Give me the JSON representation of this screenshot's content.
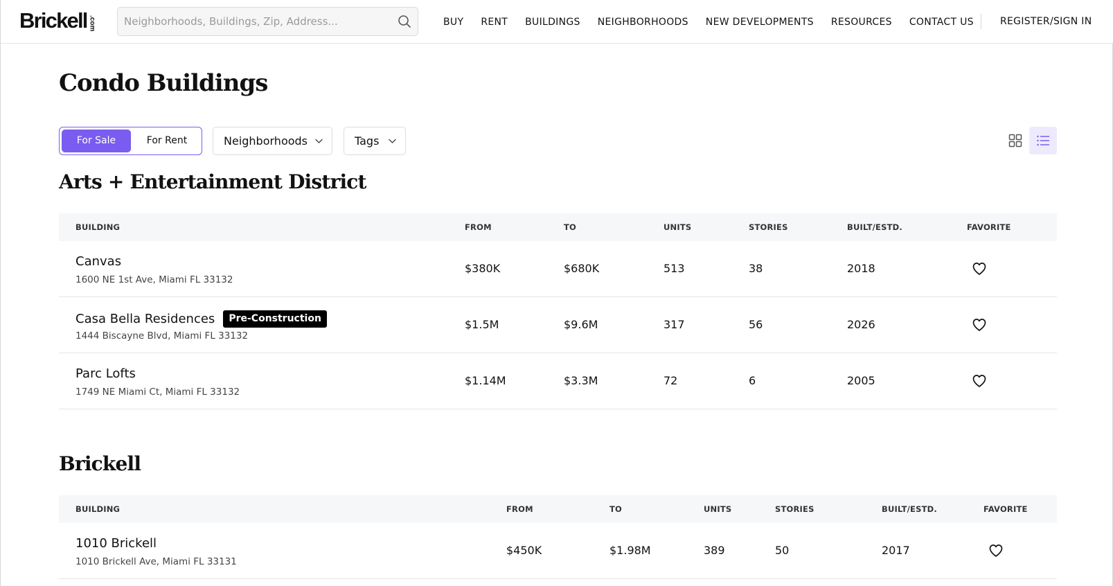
{
  "header": {
    "logo_main": "Brickell",
    "logo_sub": ".com",
    "search_placeholder": "Neighborhoods, Buildings, Zip, Address...",
    "nav": [
      "BUY",
      "RENT",
      "BUILDINGS",
      "NEIGHBORHOODS",
      "NEW DEVELOPMENTS",
      "RESOURCES",
      "CONTACT US"
    ],
    "signin": "REGISTER/SIGN IN"
  },
  "page": {
    "title": "Condo Buildings",
    "toggle": {
      "for_sale": "For Sale",
      "for_rent": "For Rent",
      "selected": "For Sale"
    },
    "filters": {
      "neighborhoods": "Neighborhoods",
      "tags": "Tags"
    },
    "view_mode": "list"
  },
  "colors": {
    "accent": "#7a5cf0",
    "accent_light": "#eeeafd",
    "badge_bg": "#000000"
  },
  "columns": [
    "BUILDING",
    "FROM",
    "TO",
    "UNITS",
    "STORIES",
    "BUILT/ESTD.",
    "FAVORITE"
  ],
  "sections": [
    {
      "title": "Arts + Entertainment District",
      "rows": [
        {
          "name": "Canvas",
          "badge": "",
          "address": "1600 NE 1st Ave, Miami FL 33132",
          "from": "$380K",
          "to": "$680K",
          "units": "513",
          "stories": "38",
          "built": "2018"
        },
        {
          "name": "Casa Bella Residences",
          "badge": "Pre-Construction",
          "address": "1444 Biscayne Blvd, Miami FL 33132",
          "from": "$1.5M",
          "to": "$9.6M",
          "units": "317",
          "stories": "56",
          "built": "2026"
        },
        {
          "name": "Parc Lofts",
          "badge": "",
          "address": "1749 NE Miami Ct, Miami FL 33132",
          "from": "$1.14M",
          "to": "$3.3M",
          "units": "72",
          "stories": "6",
          "built": "2005"
        }
      ]
    },
    {
      "title": "Brickell",
      "rows": [
        {
          "name": "1010 Brickell",
          "badge": "",
          "address": "1010 Brickell Ave, Miami FL 33131",
          "from": "$450K",
          "to": "$1.98M",
          "units": "389",
          "stories": "50",
          "built": "2017"
        }
      ]
    }
  ]
}
